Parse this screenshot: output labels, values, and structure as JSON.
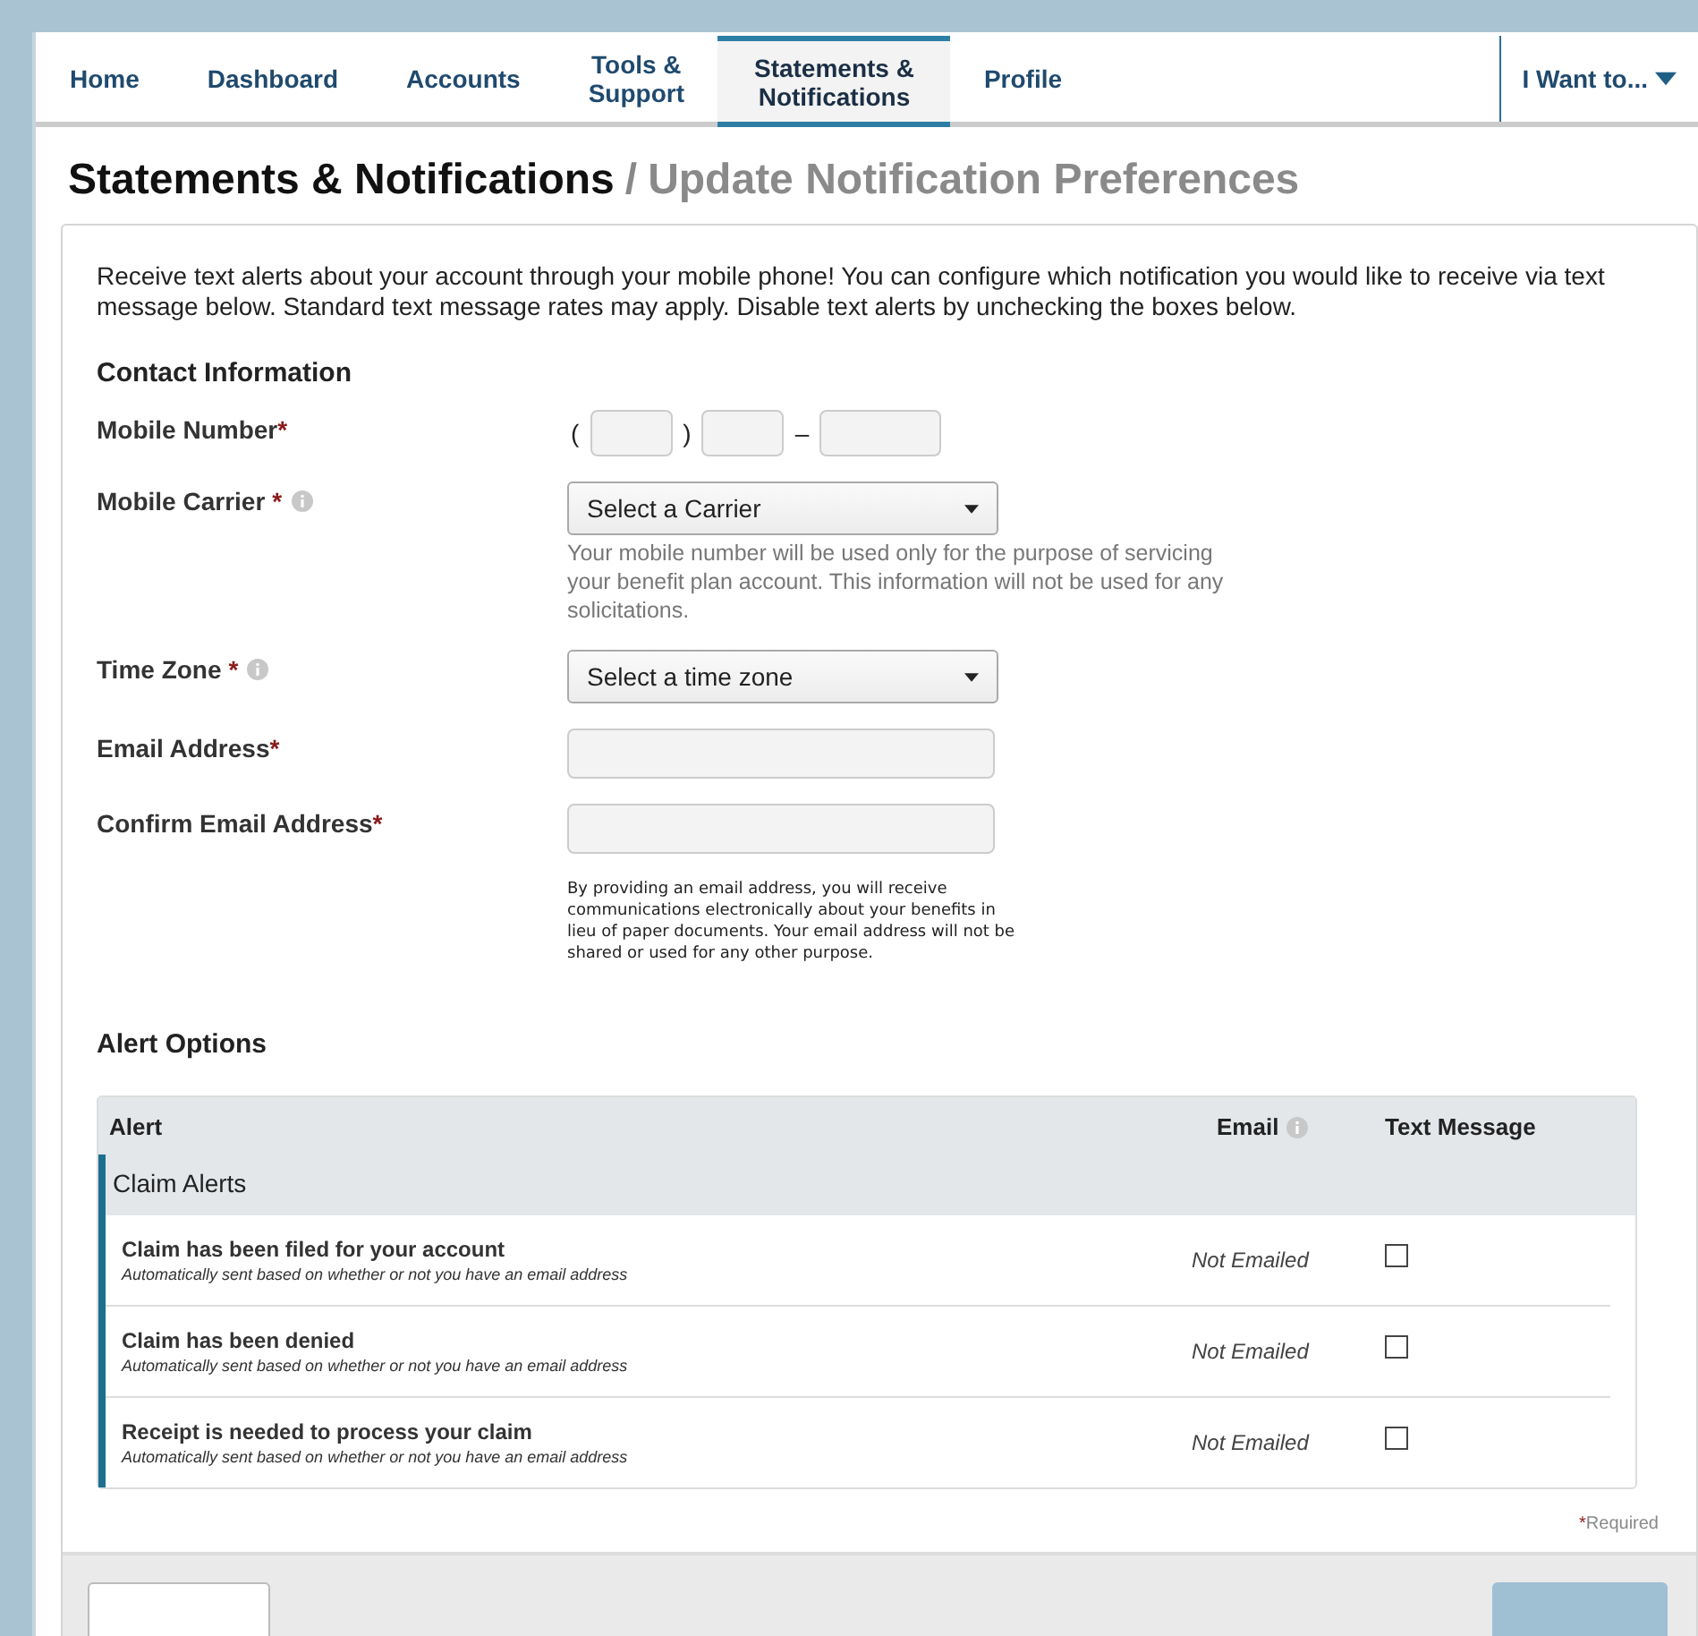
{
  "nav": {
    "tabs": [
      {
        "label": "Home",
        "selected": false
      },
      {
        "label": "Dashboard",
        "selected": false
      },
      {
        "label": "Accounts",
        "selected": false
      },
      {
        "label": "Tools &\nSupport",
        "selected": false
      },
      {
        "label": "Statements &\nNotifications",
        "selected": true
      },
      {
        "label": "Profile",
        "selected": false
      }
    ],
    "menu": {
      "label": "I Want to..."
    }
  },
  "breadcrumb": {
    "section": "Statements & Notifications",
    "separator": "/",
    "page": "Update Notification Preferences"
  },
  "intro": "Receive text alerts about your account through your mobile phone! You can configure which notification you would like to receive via text message below. Standard text message rates may apply. Disable text alerts by unchecking the boxes below.",
  "contact": {
    "heading": "Contact Information",
    "fields": [
      {
        "kind": "phone",
        "label": "Mobile Number",
        "mark": "*",
        "info": false,
        "open": "(",
        "close": ")",
        "dash": "–"
      },
      {
        "kind": "select",
        "label": "Mobile Carrier",
        "mark": "*",
        "info": true,
        "value": "Select a Carrier",
        "help": "Your mobile number will be used only for the purpose of servicing your benefit plan account. This information will not be used for any solicitations."
      },
      {
        "kind": "select",
        "label": "Time Zone",
        "mark": "*",
        "info": true,
        "value": "Select a time zone"
      },
      {
        "kind": "text",
        "label": "Email Address",
        "mark": "*",
        "info": false
      },
      {
        "kind": "text",
        "label": "Confirm Email Address",
        "mark": "*",
        "info": false,
        "note": "By providing an email address, you will receive communications electronically about your benefits in lieu of paper documents. Your email address will not be shared or used for any other purpose."
      }
    ]
  },
  "alerts": {
    "heading": "Alert Options",
    "columns": [
      {
        "label": "Alert",
        "info": false
      },
      {
        "label": "Email",
        "info": true
      },
      {
        "label": "Text Message",
        "info": false
      }
    ],
    "groups": [
      {
        "title": "Claim Alerts",
        "rows": [
          {
            "title": "Claim has been filed for your account",
            "note": "Automatically sent based on whether or not you have an email address",
            "email": "Not Emailed",
            "checked": false
          },
          {
            "title": "Claim has been denied",
            "note": "Automatically sent based on whether or not you have an email address",
            "email": "Not Emailed",
            "checked": false
          },
          {
            "title": "Receipt is needed to process your claim",
            "note": "Automatically sent based on whether or not you have an email address",
            "email": "Not Emailed",
            "checked": false
          }
        ]
      }
    ],
    "required_note": {
      "mark": "*",
      "text": "Required"
    }
  },
  "footer": {
    "buttons": [
      {
        "kind": "secondary"
      },
      {
        "kind": "primary"
      }
    ]
  }
}
